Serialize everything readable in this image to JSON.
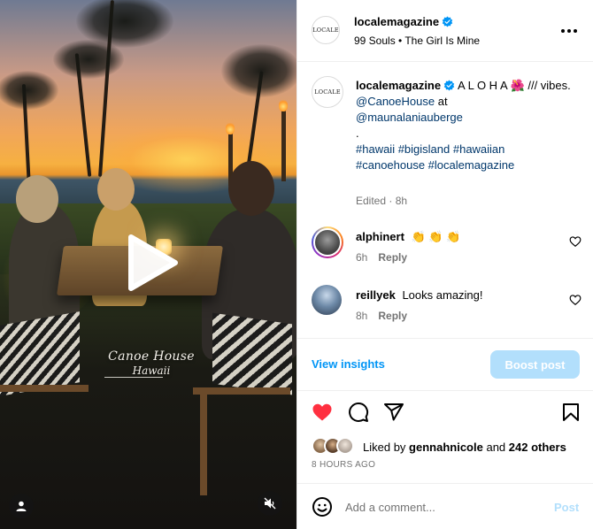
{
  "media": {
    "overlay_title": "Canoe House",
    "overlay_subtitle": "Hawaii",
    "icons": {
      "play": "play-icon",
      "user": "user-tag-icon",
      "mute": "speaker-muted-icon"
    }
  },
  "header": {
    "logo_text": "LOCALE",
    "username": "localemagazine",
    "audio": "99 Souls • The Girl Is Mine",
    "icons": {
      "verified": "verified-badge-icon",
      "more": "more-options-icon"
    }
  },
  "caption": {
    "logo_text": "LOCALE",
    "username": "localemagazine",
    "text_start": "A L O H A",
    "text_emoji": "🌺",
    "text_end": "/// vibes.",
    "mention_1": "@CanoeHouse",
    "at_word": "at",
    "mention_2": "@maunalaniauberge",
    "dot": ".",
    "hashtags_line1": "#hawaii #bigisland #hawaiian",
    "hashtags_line2": "#canoehouse #localemagazine",
    "meta": "Edited · 8h"
  },
  "comments": [
    {
      "username": "alphinert",
      "text": "👏 👏 👏",
      "time": "6h",
      "reply": "Reply"
    },
    {
      "username": "reillyek",
      "text": "Looks amazing!",
      "time": "8h",
      "reply": "Reply"
    }
  ],
  "insights": {
    "view_label": "View insights",
    "boost_label": "Boost post"
  },
  "actions": {
    "icons": [
      "heart-filled-icon",
      "comment-icon",
      "share-icon",
      "bookmark-icon"
    ],
    "like_color": "#ff3040"
  },
  "likes": {
    "prefix": "Liked by",
    "user": "gennahnicole",
    "connector": "and",
    "others": "242 others"
  },
  "timestamp": "8 HOURS AGO",
  "comment_box": {
    "placeholder": "Add a comment...",
    "post_label": "Post"
  },
  "colors": {
    "link": "#00376b",
    "accent": "#0095f6",
    "muted": "#737373",
    "boost_bg": "#b2dffc"
  }
}
